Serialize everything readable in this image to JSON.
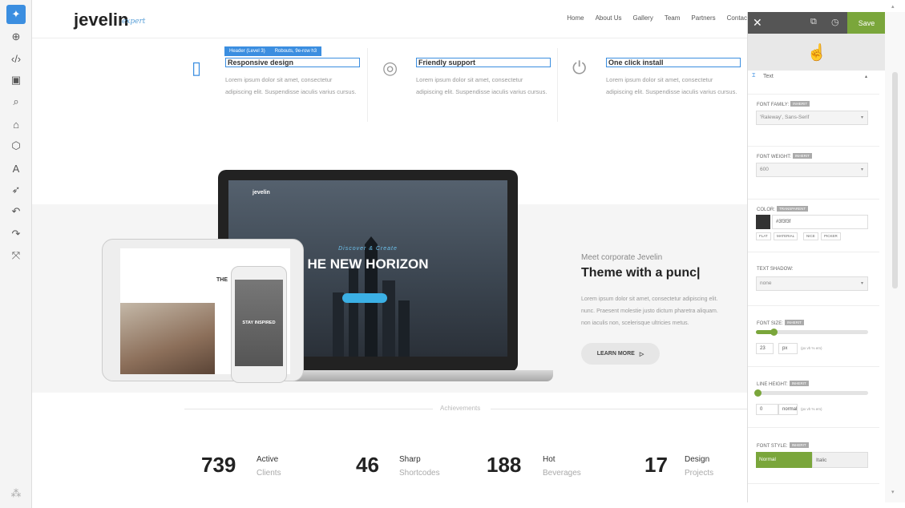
{
  "toolbar": {
    "items": [
      "cursor",
      "crosshair",
      "code",
      "layout",
      "search",
      "paint",
      "box",
      "text",
      "rocket",
      "undo",
      "redo",
      "expand"
    ],
    "footer_icon": "settings"
  },
  "site": {
    "logo": "jevelin",
    "logo_sub": "expert",
    "nav": [
      "Home",
      "About Us",
      "Gallery",
      "Team",
      "Partners",
      "Contac"
    ]
  },
  "selection": {
    "tag_a": "Header (Level 3)",
    "tag_b": "Robouts, 9e-row h3"
  },
  "features": [
    {
      "icon": "phone-icon",
      "title": "Responsive design",
      "text": "Lorem ipsum dolor sit amet, consectetur adipiscing elit. Suspendisse iaculis varius cursus."
    },
    {
      "icon": "lifebuoy-icon",
      "title": "Friendly support",
      "text": "Lorem ipsum dolor sit amet, consectetur adipiscing elit. Suspendisse iaculis varius cursus."
    },
    {
      "icon": "power-icon",
      "title": "One click install",
      "text": "Lorem ipsum dolor sit amet, consectetur adipiscing elit. Suspendisse iaculis varius cursus."
    }
  ],
  "devices": {
    "laptop_logo": "jevelin",
    "laptop_sub": "Discover & Create",
    "laptop_headline": "HE NEW HORIZON",
    "tablet_text": "THE",
    "phone_text": "STAY INSPIRED"
  },
  "promo": {
    "kicker": "Meet corporate Jevelin",
    "headline": "Theme with a punc|",
    "para_lines": [
      "Lorem ipsum dolor sit amet, consectetur adipiscing elit.",
      "nunc. Praesent molestie justo dictum pharetra aliquam.",
      "non iaculis non, scelerisque ultricies metus."
    ],
    "button": "LEARN MORE"
  },
  "achievements": {
    "label": "Achievements",
    "stats": [
      {
        "num": "739",
        "t1": "Active",
        "t2": "Clients"
      },
      {
        "num": "46",
        "t1": "Sharp",
        "t2": "Shortcodes"
      },
      {
        "num": "188",
        "t1": "Hot",
        "t2": "Beverages"
      },
      {
        "num": "17",
        "t1": "Design",
        "t2": "Projects"
      }
    ]
  },
  "panel": {
    "save": "Save",
    "section_title": "Text",
    "font_family_label": "FONT FAMILY:",
    "font_family_value": "'Raleway', Sans-Serif",
    "font_weight_label": "FONT WEIGHT:",
    "font_weight_value": "600",
    "color_label": "COLOR:",
    "color_value": "#3f3f3f",
    "color_chips": [
      "FLAT",
      "MATERIAL",
      "NICE",
      "PICKER"
    ],
    "text_shadow_label": "TEXT SHADOW:",
    "text_shadow_value": "none",
    "font_size_label": "FONT SIZE:",
    "font_size_value": "23",
    "font_size_unit": "px",
    "font_size_hint": "(px vh % em)",
    "line_height_label": "LINE HEIGHT:",
    "line_height_value": "0",
    "line_height_unit": "normal",
    "line_height_hint": "(px vh % em)",
    "font_style_label": "FONT STYLE:",
    "font_style_options": [
      "Normal",
      "Italic"
    ],
    "badge": "INHERIT",
    "badge_color": "TRANSPARENT",
    "font_size_fraction": 0.16,
    "line_height_fraction": 0.0,
    "accent": "#7aa63b",
    "selection_color": "#3b8ee0"
  }
}
